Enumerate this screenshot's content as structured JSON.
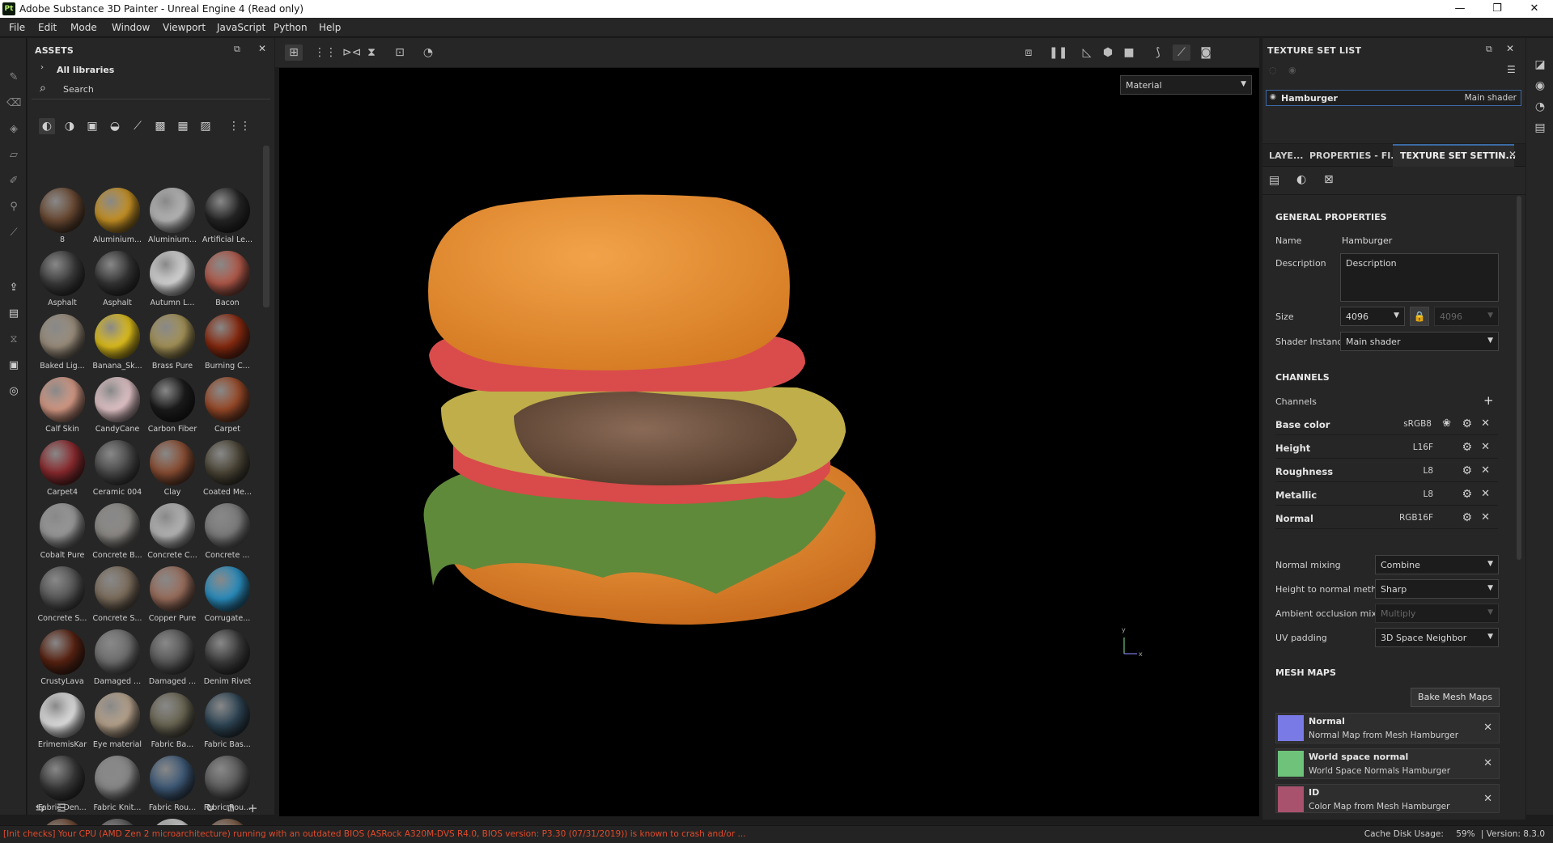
{
  "window": {
    "title": "Adobe Substance 3D Painter - Unreal Engine 4 (Read only)",
    "app_badge": "Pt",
    "minimize": "—",
    "maximize": "❐",
    "close": "✕"
  },
  "menu": [
    "File",
    "Edit",
    "Mode",
    "Window",
    "Viewport",
    "JavaScript",
    "Python",
    "Help"
  ],
  "assets": {
    "title": "ASSETS",
    "library": "All libraries",
    "search_placeholder": "Search",
    "items": [
      {
        "label": "8",
        "color": "#6b4a33"
      },
      {
        "label": "Aluminium...",
        "color": "#c99324"
      },
      {
        "label": "Aluminium...",
        "color": "#b9b9b9"
      },
      {
        "label": "Artificial Le...",
        "color": "#262626"
      },
      {
        "label": "Asphalt",
        "color": "#3b3b3b"
      },
      {
        "label": "Asphalt",
        "color": "#353535"
      },
      {
        "label": "Autumn L...",
        "color": "#d9d9d9"
      },
      {
        "label": "Bacon",
        "color": "#b35a4a"
      },
      {
        "label": "Baked Lig...",
        "color": "#9c8f7d"
      },
      {
        "label": "Banana_Sk...",
        "color": "#e3c21c"
      },
      {
        "label": "Brass Pure",
        "color": "#a69458"
      },
      {
        "label": "Burning C...",
        "color": "#8a2a0f"
      },
      {
        "label": "Calf Skin",
        "color": "#d89b86"
      },
      {
        "label": "CandyCane",
        "color": "#e7c8cc"
      },
      {
        "label": "Carbon Fiber",
        "color": "#1c1c1c"
      },
      {
        "label": "Carpet",
        "color": "#9a4a28"
      },
      {
        "label": "Carpet4",
        "color": "#8c2a2e"
      },
      {
        "label": "Ceramic 004",
        "color": "#4a4a4a"
      },
      {
        "label": "Clay",
        "color": "#8b4e33"
      },
      {
        "label": "Coated Me...",
        "color": "#4c4637"
      },
      {
        "label": "Cobalt Pure",
        "color": "#9a9a9a"
      },
      {
        "label": "Concrete B...",
        "color": "#8d8a86"
      },
      {
        "label": "Concrete C...",
        "color": "#b8b8b8"
      },
      {
        "label": "Concrete ...",
        "color": "#7c7c7c"
      },
      {
        "label": "Concrete S...",
        "color": "#575757"
      },
      {
        "label": "Concrete S...",
        "color": "#7d6e5d"
      },
      {
        "label": "Copper Pure",
        "color": "#9a6e5c"
      },
      {
        "label": "Corrugate...",
        "color": "#2a8fc1"
      },
      {
        "label": "CrustyLava",
        "color": "#5a2312"
      },
      {
        "label": "Damaged ...",
        "color": "#6f6f6f"
      },
      {
        "label": "Damaged ...",
        "color": "#595959"
      },
      {
        "label": "Denim Rivet",
        "color": "#3c3c3c"
      },
      {
        "label": "ErimemisKar",
        "color": "#e4e4e4"
      },
      {
        "label": "Eye material",
        "color": "#b9a58e"
      },
      {
        "label": "Fabric Ba...",
        "color": "#6b6754"
      },
      {
        "label": "Fabric Bas...",
        "color": "#2f4656"
      },
      {
        "label": "Fabric Den...",
        "color": "#3a3a3a"
      },
      {
        "label": "Fabric Knit...",
        "color": "#8a8a8a"
      },
      {
        "label": "Fabric Rou...",
        "color": "#3e5a78"
      },
      {
        "label": "Fabric Rou...",
        "color": "#5b5b5b"
      },
      {
        "label": "",
        "color": "#6e4a33"
      },
      {
        "label": "",
        "color": "#5a5a5a"
      },
      {
        "label": "",
        "color": "#cfcfcf"
      },
      {
        "label": "",
        "color": "#7b5a44"
      }
    ]
  },
  "viewport": {
    "display_mode": "Material",
    "axis_x": "x",
    "axis_y": "y"
  },
  "texture_set_list": {
    "title": "TEXTURE SET LIST",
    "set_name": "Hamburger",
    "set_shader": "Main shader"
  },
  "tabs": [
    "LAYE...",
    "PROPERTIES - FI...",
    "TEXTURE SET SETTIN..."
  ],
  "settings": {
    "general_title": "GENERAL PROPERTIES",
    "name_label": "Name",
    "name_value": "Hamburger",
    "description_label": "Description",
    "description_value": "Description",
    "size_label": "Size",
    "size_value": "4096",
    "size_value_2": "4096",
    "shader_label": "Shader Instance",
    "shader_value": "Main shader",
    "channels_title": "CHANNELS",
    "channels_label": "Channels",
    "channels": [
      {
        "name": "Base color",
        "format": "sRGB8"
      },
      {
        "name": "Height",
        "format": "L16F"
      },
      {
        "name": "Roughness",
        "format": "L8"
      },
      {
        "name": "Metallic",
        "format": "L8"
      },
      {
        "name": "Normal",
        "format": "RGB16F"
      }
    ],
    "normal_mixing_label": "Normal mixing",
    "normal_mixing_value": "Combine",
    "height_normal_label": "Height to normal method",
    "height_normal_value": "Sharp",
    "ao_mixing_label": "Ambient occlusion mixing",
    "ao_mixing_value": "Multiply",
    "uv_padding_label": "UV padding",
    "uv_padding_value": "3D Space Neighbor",
    "mesh_maps_title": "MESH MAPS",
    "bake_button": "Bake Mesh Maps",
    "mesh_maps": [
      {
        "name": "Normal",
        "desc": "Normal Map from Mesh Hamburger",
        "color": "#7a7ae6"
      },
      {
        "name": "World space normal",
        "desc": "World Space Normals Hamburger",
        "color": "#6ec27a"
      },
      {
        "name": "ID",
        "desc": "Color Map from Mesh Hamburger",
        "color": "#a8526e"
      }
    ]
  },
  "status": {
    "message": "[Init checks] Your CPU (AMD Zen 2 microarchitecture) running with an outdated BIOS (ASRock A320M-DVS R4.0, BIOS version: P3.30 (07/31/2019)) is known to crash and/or ...",
    "cache_label": "Cache Disk Usage:",
    "cache_value": "59%",
    "version": "| Version: 8.3.0"
  }
}
